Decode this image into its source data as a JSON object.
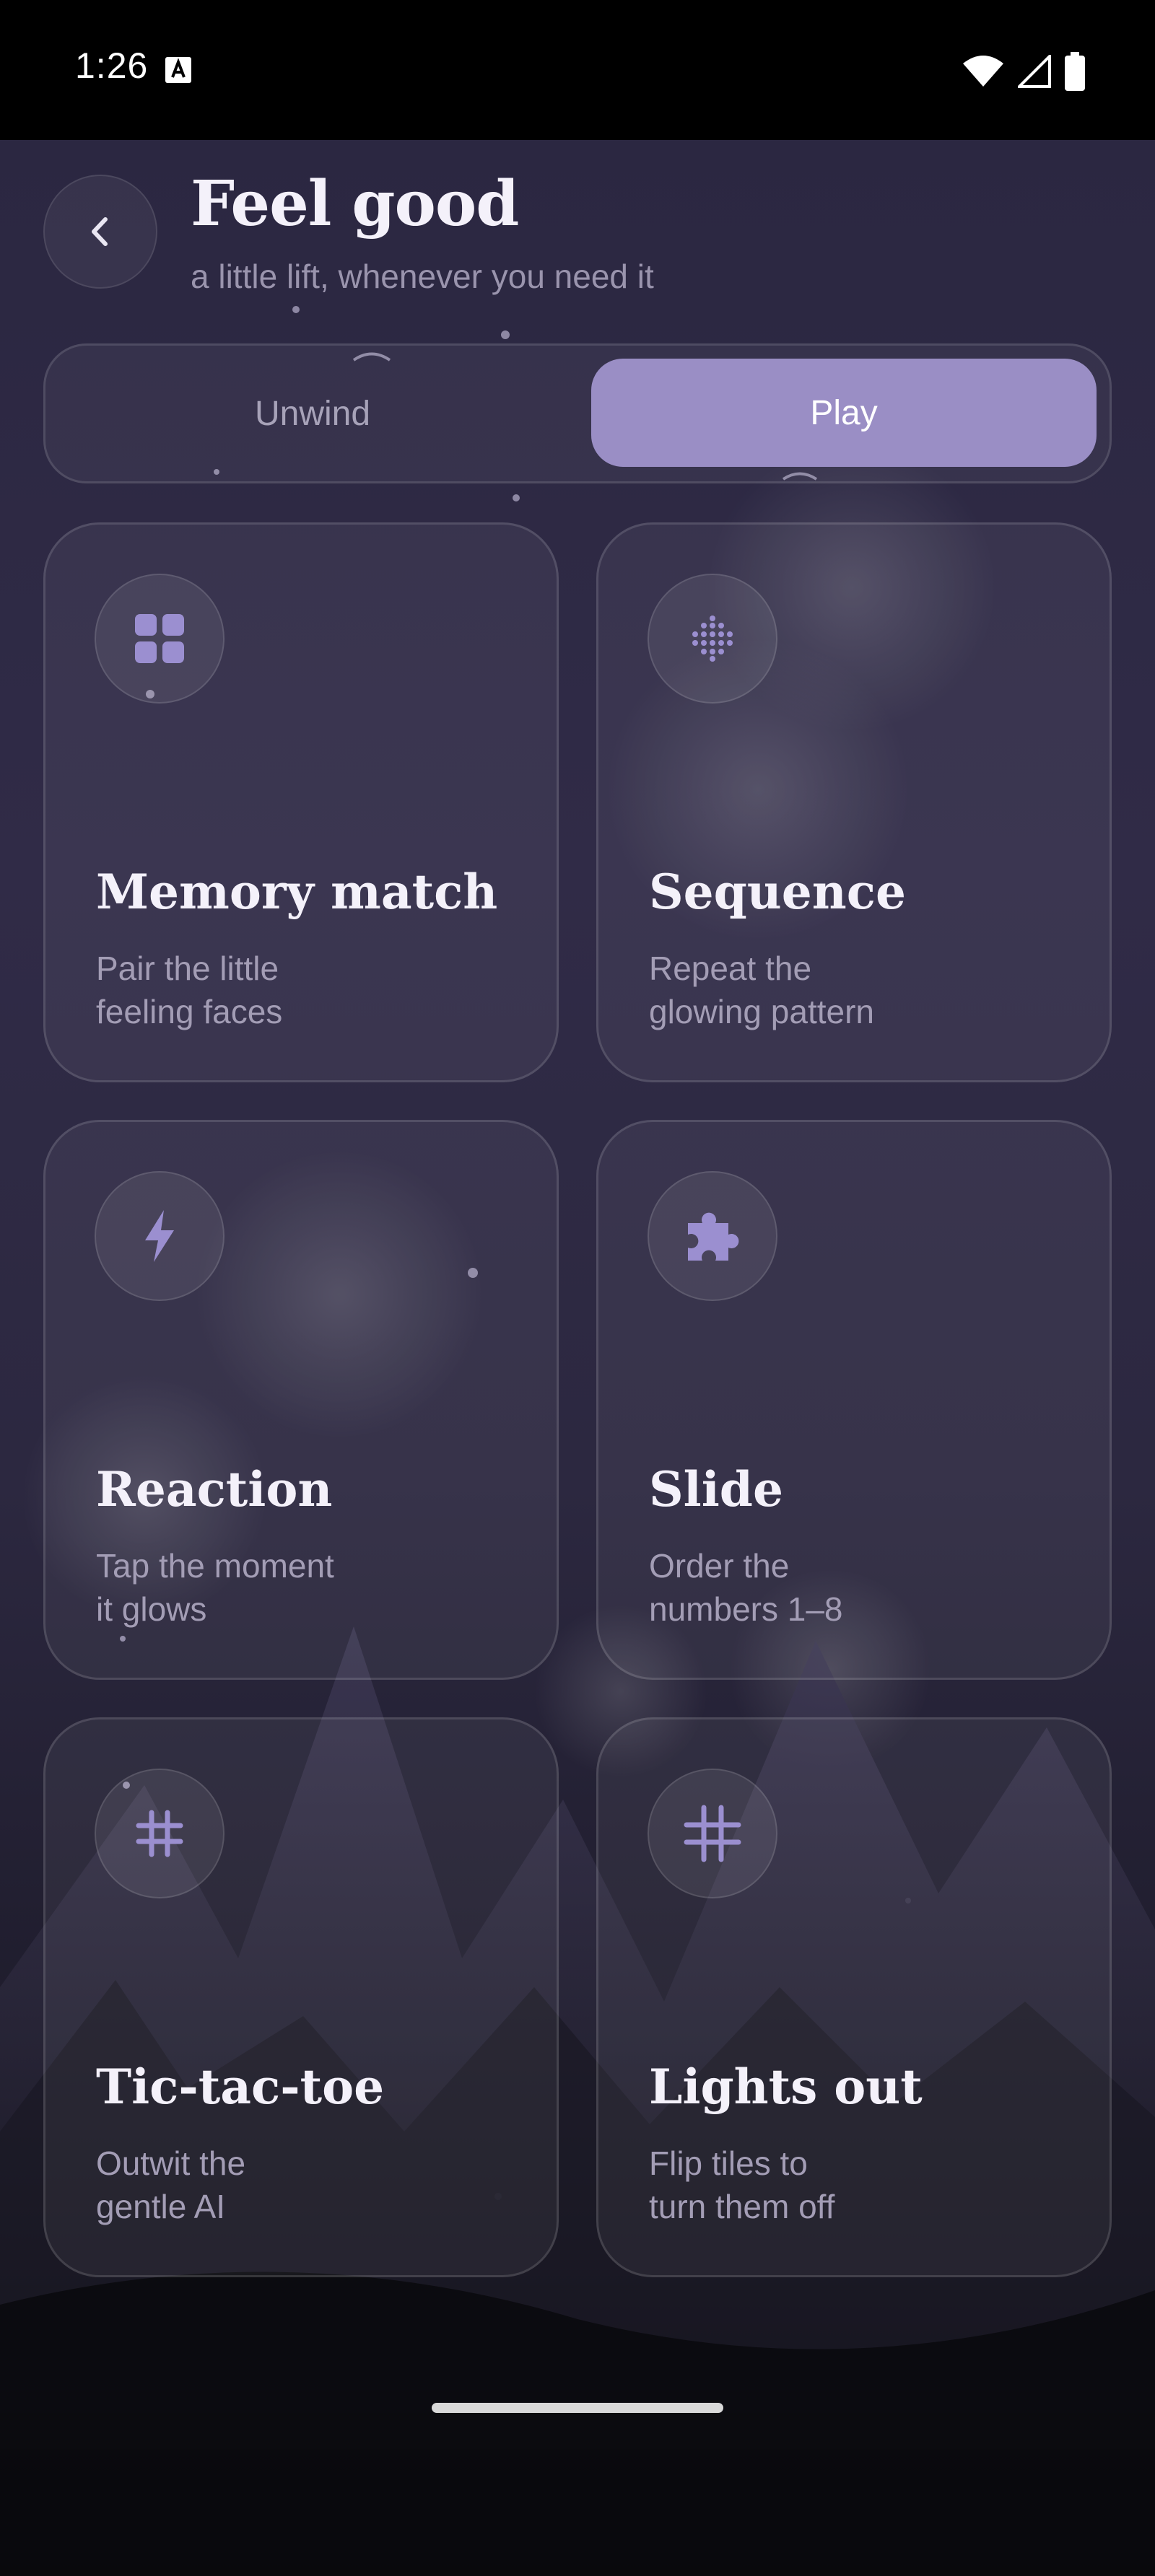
{
  "status_bar": {
    "time": "1:26",
    "icons": [
      "keyboard-a-icon",
      "wifi-icon",
      "signal-icon",
      "battery-icon"
    ]
  },
  "header": {
    "title": "Feel good",
    "subtitle": "a little lift, whenever you need it",
    "back_icon": "chevron-left-icon"
  },
  "tabs": [
    {
      "label": "Unwind",
      "selected": false
    },
    {
      "label": "Play",
      "selected": true
    }
  ],
  "colors": {
    "accent": "#9a8ec5",
    "icon_tint": "#9b8fd0",
    "background_top": "#2b2741",
    "background_bottom": "#09090d"
  },
  "games": [
    {
      "title": "Memory match",
      "desc_line1": "Pair the little",
      "desc_line2": "feeling faces",
      "icon": "grid-icon"
    },
    {
      "title": "Sequence",
      "desc_line1": "Repeat the",
      "desc_line2": "glowing pattern",
      "icon": "dot-matrix-icon"
    },
    {
      "title": "Reaction",
      "desc_line1": "Tap the moment",
      "desc_line2": "it glows",
      "icon": "lightning-icon"
    },
    {
      "title": "Slide",
      "desc_line1": "Order the",
      "desc_line2": "numbers 1–8",
      "icon": "puzzle-icon"
    },
    {
      "title": "Tic-tac-toe",
      "desc_line1": "Outwit the",
      "desc_line2": "gentle AI",
      "icon": "hash-icon"
    },
    {
      "title": "Lights out",
      "desc_line1": "Flip tiles to",
      "desc_line2": "turn them off",
      "icon": "grid-lines-icon"
    }
  ]
}
